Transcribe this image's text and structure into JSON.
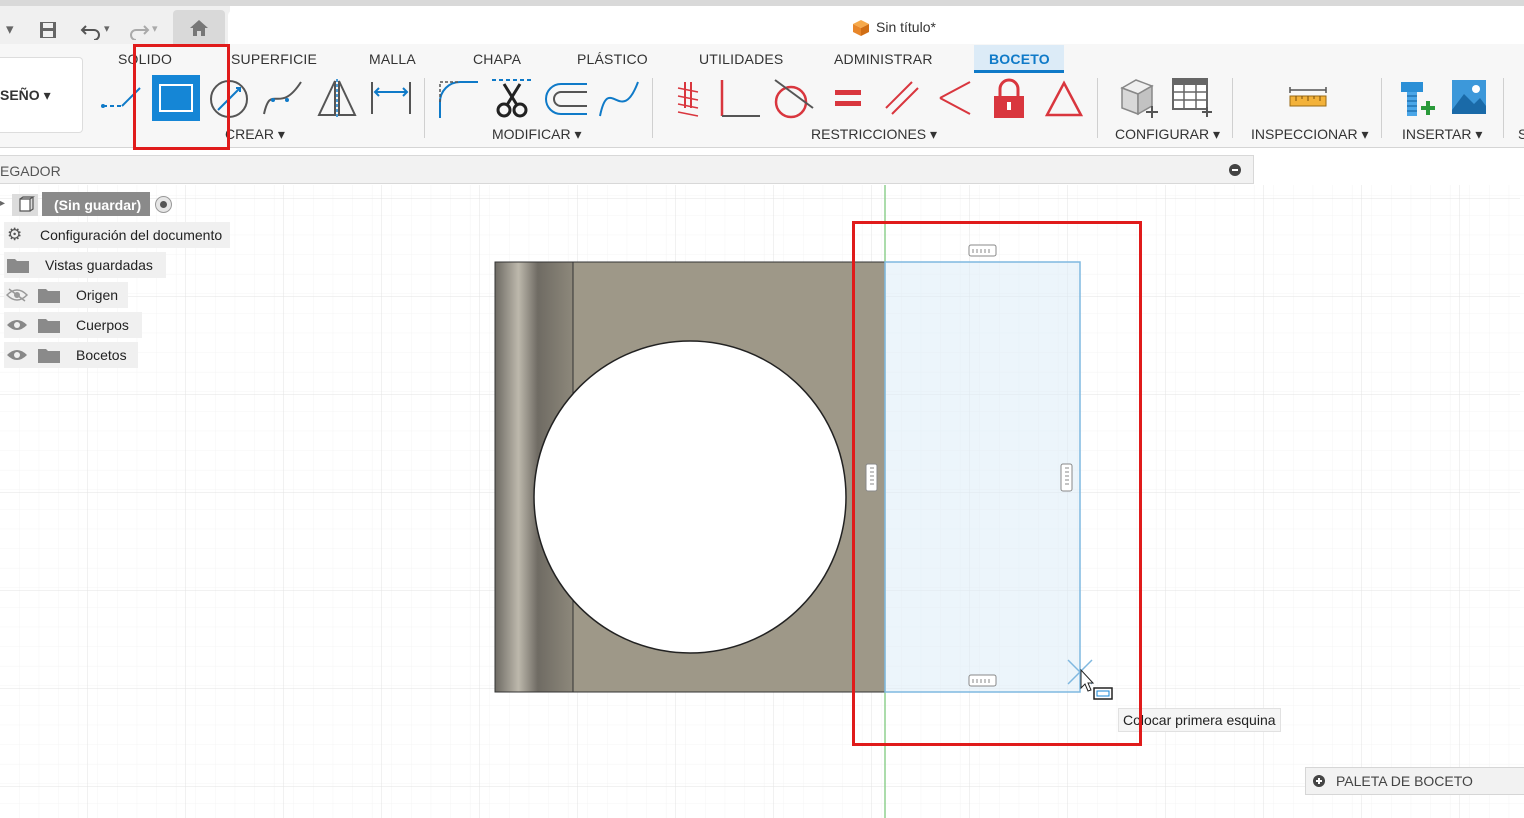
{
  "document": {
    "title": "Sin título*"
  },
  "workspace": {
    "label": "SEÑO ▾"
  },
  "tabs": [
    {
      "label": "SOLIDO"
    },
    {
      "label": "SUPERFICIE"
    },
    {
      "label": "MALLA"
    },
    {
      "label": "CHAPA"
    },
    {
      "label": "PLÁSTICO"
    },
    {
      "label": "UTILIDADES"
    },
    {
      "label": "ADMINISTRAR"
    },
    {
      "label": "BOCETO"
    }
  ],
  "groups": {
    "crear": "CREAR ▾",
    "modificar": "MODIFICAR ▾",
    "restricciones": "RESTRICCIONES ▾",
    "configurar": "CONFIGURAR ▾",
    "inspeccionar": "INSPECCIONAR ▾",
    "insertar": "INSERTAR ▾",
    "cut_off": "S"
  },
  "browser": {
    "title": "EGADOR",
    "root": "(Sin guardar)",
    "items": [
      {
        "label": "Configuración del documento",
        "icon": "gear-icon"
      },
      {
        "label": "Vistas guardadas",
        "icon": "folder-icon"
      },
      {
        "label": "Origen",
        "icon": "folder-icon",
        "visibility": "hidden"
      },
      {
        "label": "Cuerpos",
        "icon": "folder-icon",
        "visibility": "visible"
      },
      {
        "label": "Bocetos",
        "icon": "folder-icon",
        "visibility": "visible"
      }
    ]
  },
  "canvas": {
    "tooltip": "Colocar primera esquina"
  },
  "palette": {
    "label": "PALETA DE BOCETO"
  },
  "colors": {
    "accent": "#0f7ac8",
    "highlight_box": "#e01b1b",
    "constraint_red": "#d9363e",
    "part_body": "#9e9888"
  }
}
